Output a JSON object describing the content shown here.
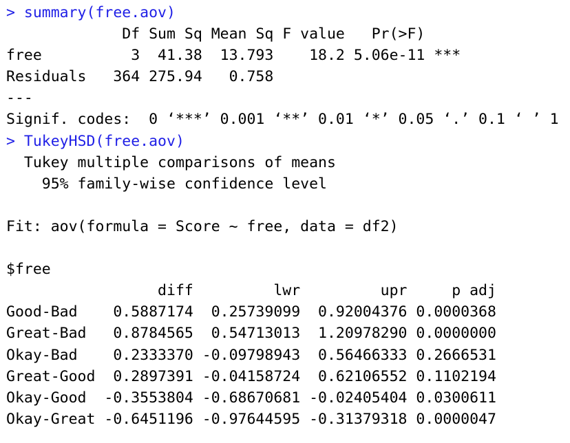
{
  "colors": {
    "command": "#1f1fe6",
    "output": "#000000",
    "background": "#ffffff"
  },
  "console": {
    "lines": [
      {
        "kind": "command",
        "text": "> summary(free.aov)"
      },
      {
        "kind": "output",
        "text": "             Df Sum Sq Mean Sq F value   Pr(>F)    "
      },
      {
        "kind": "output",
        "text": "free          3  41.38  13.793    18.2 5.06e-11 ***"
      },
      {
        "kind": "output",
        "text": "Residuals   364 275.94   0.758                     "
      },
      {
        "kind": "output",
        "text": "---"
      },
      {
        "kind": "output",
        "text": "Signif. codes:  0 ‘***’ 0.001 ‘**’ 0.01 ‘*’ 0.05 ‘.’ 0.1 ‘ ’ 1"
      },
      {
        "kind": "command",
        "text": "> TukeyHSD(free.aov)"
      },
      {
        "kind": "output",
        "text": "  Tukey multiple comparisons of means"
      },
      {
        "kind": "output",
        "text": "    95% family-wise confidence level"
      },
      {
        "kind": "output",
        "text": ""
      },
      {
        "kind": "output",
        "text": "Fit: aov(formula = Score ~ free, data = df2)"
      },
      {
        "kind": "output",
        "text": ""
      },
      {
        "kind": "output",
        "text": "$free"
      },
      {
        "kind": "output",
        "text": "                 diff         lwr         upr     p adj"
      },
      {
        "kind": "output",
        "text": "Good-Bad    0.5887174  0.25739099  0.92004376 0.0000368"
      },
      {
        "kind": "output",
        "text": "Great-Bad   0.8784565  0.54713013  1.20978290 0.0000000"
      },
      {
        "kind": "output",
        "text": "Okay-Bad    0.2333370 -0.09798943  0.56466333 0.2666531"
      },
      {
        "kind": "output",
        "text": "Great-Good  0.2897391 -0.04158724  0.62106552 0.1102194"
      },
      {
        "kind": "output",
        "text": "Okay-Good  -0.3553804 -0.68670681 -0.02405404 0.0300611"
      },
      {
        "kind": "output",
        "text": "Okay-Great -0.6451196 -0.97644595 -0.31379318 0.0000047"
      }
    ]
  }
}
